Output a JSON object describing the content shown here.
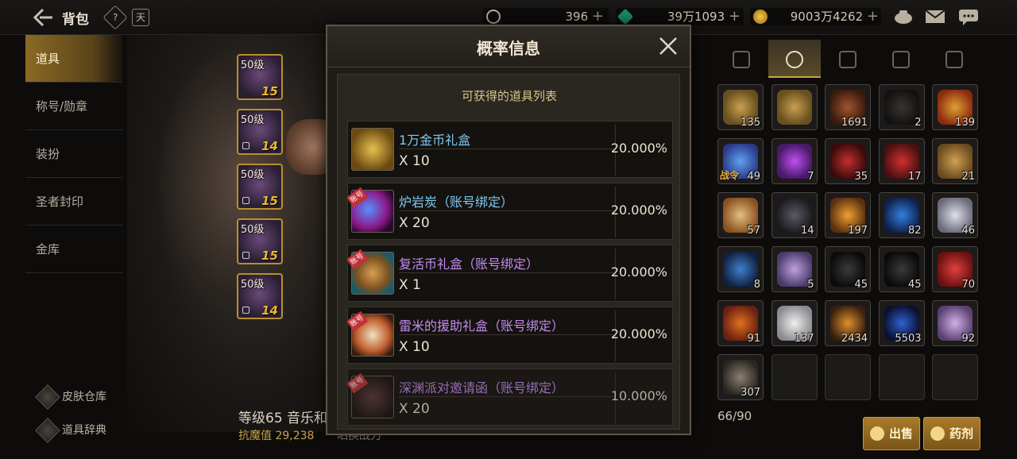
{
  "header": {
    "title": "背包",
    "help_icon_text": "?",
    "calendar_icon_text": "天",
    "currencies": [
      {
        "icon": "c-coin-icon",
        "value": "396"
      },
      {
        "icon": "green-gem-icon",
        "value": "39万1093"
      },
      {
        "icon": "gold-coin-icon",
        "value": "9003万4262"
      }
    ]
  },
  "left_menu": {
    "items": [
      {
        "label": "道具",
        "active": true
      },
      {
        "label": "称号/勋章"
      },
      {
        "label": "装扮"
      },
      {
        "label": "圣者封印"
      },
      {
        "label": "金库"
      }
    ],
    "bottom_links": [
      {
        "label": "皮肤仓库"
      },
      {
        "label": "道具辞典"
      }
    ]
  },
  "equip_slots": [
    {
      "level": "50级",
      "num": "15",
      "locked": false
    },
    {
      "level": "50级",
      "num": "14",
      "locked": true
    },
    {
      "level": "50级",
      "num": "15",
      "locked": true
    },
    {
      "level": "50级",
      "num": "15",
      "locked": true
    },
    {
      "level": "50级",
      "num": "14",
      "locked": true
    }
  ],
  "character": {
    "name": "等级65 音乐和",
    "stat": "抗魔值 29,238",
    "stat_extra": "晒换战力"
  },
  "modal": {
    "title": "概率信息",
    "subtitle": "可获得的道具列表",
    "items": [
      {
        "name": "1万金币礼盒",
        "qty": "X 10",
        "pct": "20.000%",
        "color": "blue",
        "badge": ""
      },
      {
        "name": "炉岩炭（账号绑定）",
        "qty": "X 20",
        "pct": "20.000%",
        "color": "blue",
        "badge": "账号"
      },
      {
        "name": "复活币礼盒（账号绑定）",
        "qty": "X 1",
        "pct": "20.000%",
        "color": "purple",
        "badge": "账号"
      },
      {
        "name": "雷米的援助礼盒（账号绑定）",
        "qty": "X 10",
        "pct": "20.000%",
        "color": "purple",
        "badge": "账号"
      },
      {
        "name": "深渊派对邀请函（账号绑定）",
        "qty": "X 20",
        "pct": "10.000%",
        "color": "purple",
        "badge": "账号"
      }
    ]
  },
  "inventory": {
    "capacity": "66/90",
    "cells": [
      {
        "count": "135",
        "tag": ""
      },
      {
        "count": "",
        "tag": ""
      },
      {
        "count": "1691",
        "tag": ""
      },
      {
        "count": "2",
        "tag": ""
      },
      {
        "count": "139",
        "tag": ""
      },
      {
        "count": "49",
        "tag": "战令"
      },
      {
        "count": "7",
        "tag": ""
      },
      {
        "count": "35",
        "tag": ""
      },
      {
        "count": "17",
        "tag": ""
      },
      {
        "count": "21",
        "tag": ""
      },
      {
        "count": "57",
        "tag": ""
      },
      {
        "count": "14",
        "tag": ""
      },
      {
        "count": "197",
        "tag": ""
      },
      {
        "count": "82",
        "tag": ""
      },
      {
        "count": "46",
        "tag": ""
      },
      {
        "count": "8",
        "tag": ""
      },
      {
        "count": "5",
        "tag": ""
      },
      {
        "count": "45",
        "tag": ""
      },
      {
        "count": "45",
        "tag": ""
      },
      {
        "count": "70",
        "tag": ""
      },
      {
        "count": "91",
        "tag": ""
      },
      {
        "count": "137",
        "tag": ""
      },
      {
        "count": "2434",
        "tag": ""
      },
      {
        "count": "5503",
        "tag": ""
      },
      {
        "count": "92",
        "tag": ""
      },
      {
        "count": "307",
        "tag": ""
      },
      {
        "count": "",
        "tag": ""
      },
      {
        "count": "",
        "tag": ""
      },
      {
        "count": "",
        "tag": ""
      },
      {
        "count": "",
        "tag": ""
      }
    ],
    "sell_label": "出售",
    "potion_label": "药剂"
  },
  "colors": {
    "accent_gold": "#c9a24a",
    "item_blue": "#7fc8f0",
    "item_purple": "#c58af0"
  }
}
